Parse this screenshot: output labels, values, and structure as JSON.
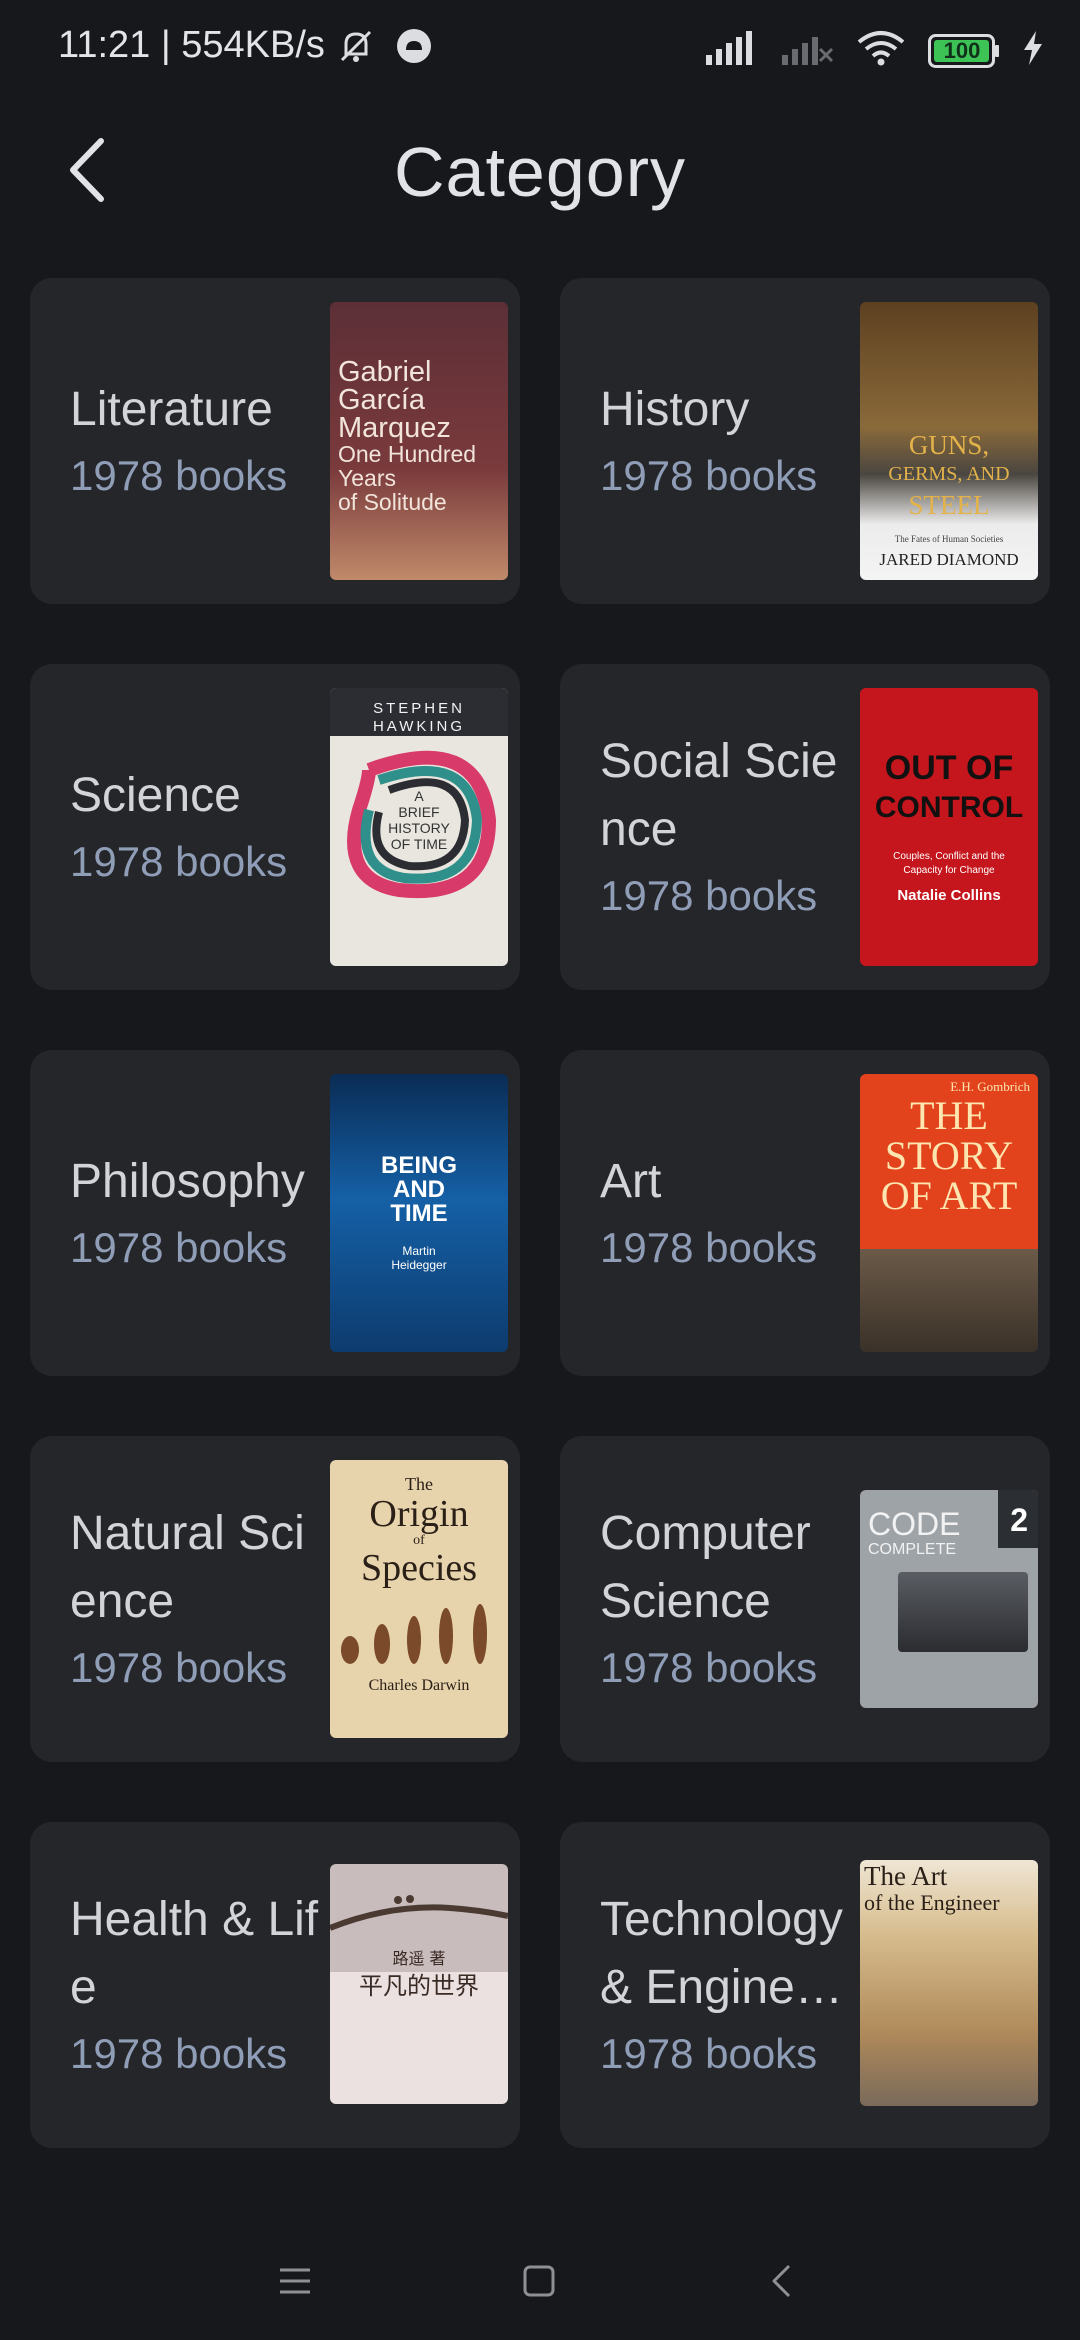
{
  "status_bar": {
    "time": "11:21 | 554KB/s",
    "battery": "100",
    "icons": [
      "mute-bell-icon",
      "android-icon",
      "signal-icon",
      "signal-off-icon",
      "wifi-icon",
      "battery-icon",
      "charging-icon"
    ]
  },
  "header": {
    "title": "Category",
    "back_icon": "chevron-left-icon"
  },
  "categories": [
    {
      "name": "Literature",
      "count": "1978 books",
      "cover": {
        "lines": [
          "Gabriel",
          "García",
          "Marquez",
          "One Hundred",
          "Years",
          "of Solitude"
        ],
        "bg": "#5a2e35"
      }
    },
    {
      "name": "History",
      "count": "1978 books",
      "cover": {
        "lines": [
          "GUNS,",
          "GERMS, AND",
          "STEEL",
          "The Fates of Human Societies",
          "JARED DIAMOND"
        ],
        "bg": "#6b4a2a"
      }
    },
    {
      "name": "Science",
      "count": "1978 books",
      "cover": {
        "lines": [
          "STEPHEN",
          "HAWKING",
          "A",
          "BRIEF",
          "HISTORY",
          "OF TIME"
        ],
        "bg": "#e9e6df"
      }
    },
    {
      "name": "Social Science",
      "count": "1978 books",
      "cover": {
        "lines": [
          "OUT OF",
          "CONTROL",
          "Couples, Conflict and the",
          "Capacity for Change",
          "Natalie Collins"
        ],
        "bg": "#c4161c"
      }
    },
    {
      "name": "Philosophy",
      "count": "1978 books",
      "cover": {
        "lines": [
          "BEING",
          "AND",
          "TIME",
          "Martin",
          "Heidegger"
        ],
        "bg": "#0d3b6e"
      }
    },
    {
      "name": "Art",
      "count": "1978 books",
      "cover": {
        "lines": [
          "E.H. Gombrich",
          "THE",
          "STORY",
          "OF ART"
        ],
        "bg": "#e2431c"
      }
    },
    {
      "name": "Natural Science",
      "count": "1978 books",
      "cover": {
        "lines": [
          "The",
          "Origin",
          "of",
          "Species",
          "Charles Darwin"
        ],
        "bg": "#e8d4ac"
      }
    },
    {
      "name": "Computer Science",
      "count": "1978 books",
      "cover": {
        "lines": [
          "CODE",
          "COMPLETE",
          "2"
        ],
        "bg": "#9ea3a8"
      }
    },
    {
      "name": "Health & Life",
      "count": "1978 books",
      "cover": {
        "lines": [
          "路遥 著",
          "平凡的世界"
        ],
        "bg": "#dcd2d2"
      }
    },
    {
      "name": "Technology & Engineering",
      "count": "1978 books",
      "cover": {
        "lines": [
          "The Art",
          "of the Engineer"
        ],
        "bg": "#c9b48e"
      }
    }
  ],
  "nav_bar": {
    "icons": [
      "menu-icon",
      "home-square-icon",
      "back-triangle-icon"
    ]
  }
}
